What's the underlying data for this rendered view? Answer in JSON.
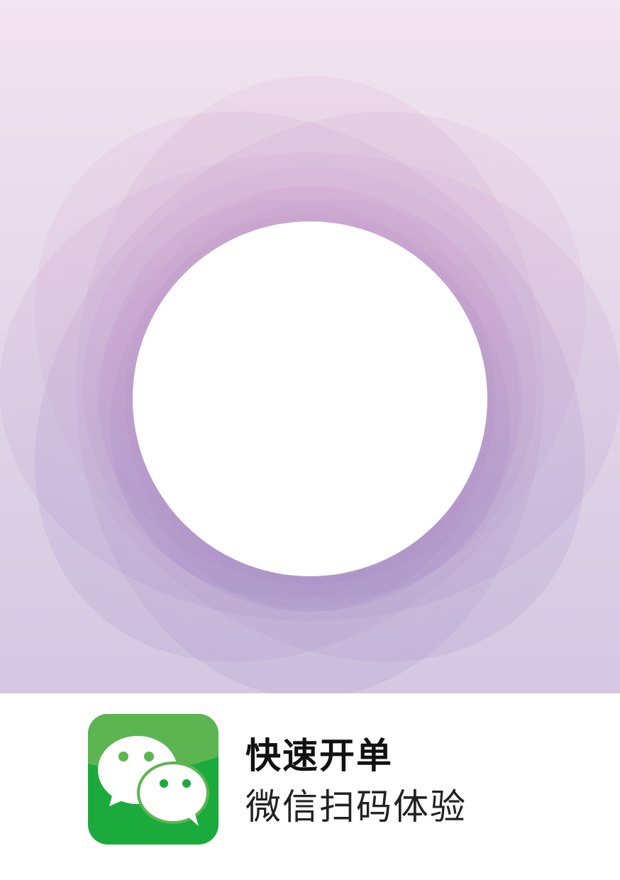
{
  "colors": {
    "background_top": "#f3e4ef",
    "background_bottom": "#d3c8e2",
    "petal_top": "#d6a8cf",
    "petal_bottom": "#9d88c2",
    "center_circle": "#ffffff",
    "wechat_green_light": "#5cb551",
    "wechat_green_dark": "#1aab3c"
  },
  "footer": {
    "icon": "wechat-icon",
    "title": "快速开单",
    "subtitle": "微信扫码体验"
  }
}
